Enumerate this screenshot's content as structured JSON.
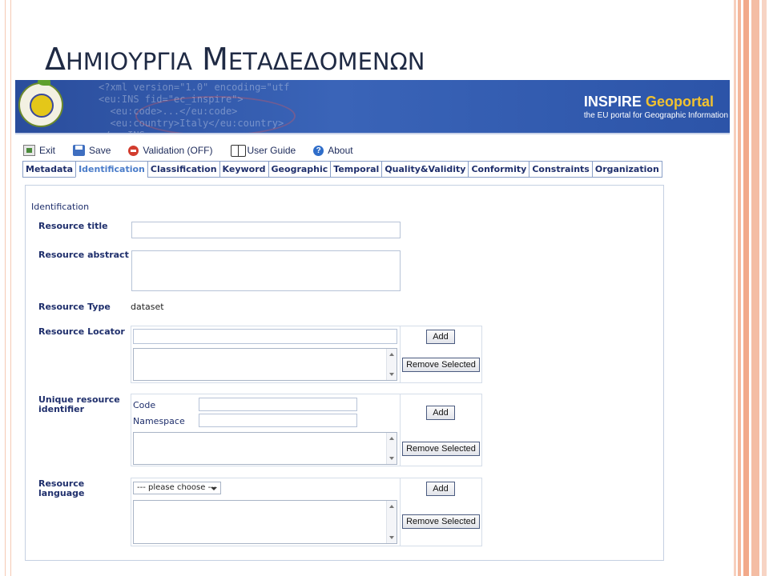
{
  "slide": {
    "title_first_letter_1": "Δ",
    "title_rest_1": "ΗΜΙΟΥΡΓΙΑ",
    "title_first_letter_2": "Μ",
    "title_rest_2": "ΕΤΑΔΕΔΟΜΕΝΩΝ"
  },
  "banner": {
    "xml_snippet": "<?xml version=\"1.0\" encoding=\"utf\n<eu:INS fid=\"ec_inspire\">\n  <eu:code>...</eu:code>\n  <eu:country>Italy</eu:country>\n</eu:INS>",
    "brand_inspire": "INSPIRE",
    "brand_geoportal": "Geoportal",
    "brand_tagline": "the EU portal for Geographic Information",
    "colors": {
      "banner": "#3a64b8",
      "brand_accent": "#f2c230"
    }
  },
  "toolbar": {
    "exit": "Exit",
    "save": "Save",
    "validation": "Validation (OFF)",
    "user_guide": "User Guide",
    "about": "About"
  },
  "tabs": [
    {
      "label": "Metadata",
      "active": false
    },
    {
      "label": "Identification",
      "active": true
    },
    {
      "label": "Classification",
      "active": false
    },
    {
      "label": "Keyword",
      "active": false
    },
    {
      "label": "Geographic",
      "active": false
    },
    {
      "label": "Temporal",
      "active": false
    },
    {
      "label": "Quality&Validity",
      "active": false
    },
    {
      "label": "Conformity",
      "active": false
    },
    {
      "label": "Constraints",
      "active": false
    },
    {
      "label": "Organization",
      "active": false
    }
  ],
  "form": {
    "section_title": "Identification",
    "resource_title_label": "Resource title",
    "resource_title_value": "",
    "resource_abstract_label": "Resource abstract",
    "resource_abstract_value": "",
    "resource_type_label": "Resource Type",
    "resource_type_value": "dataset",
    "resource_locator_label": "Resource Locator",
    "resource_locator_value": "",
    "unique_identifier_label_1": "Unique resource",
    "unique_identifier_label_2": "identifier",
    "code_label": "Code",
    "namespace_label": "Namespace",
    "resource_language_label_1": "Resource",
    "resource_language_label_2": "language",
    "language_select_value": "--- please choose ---",
    "add_button": "Add",
    "remove_selected_button": "Remove Selected"
  }
}
